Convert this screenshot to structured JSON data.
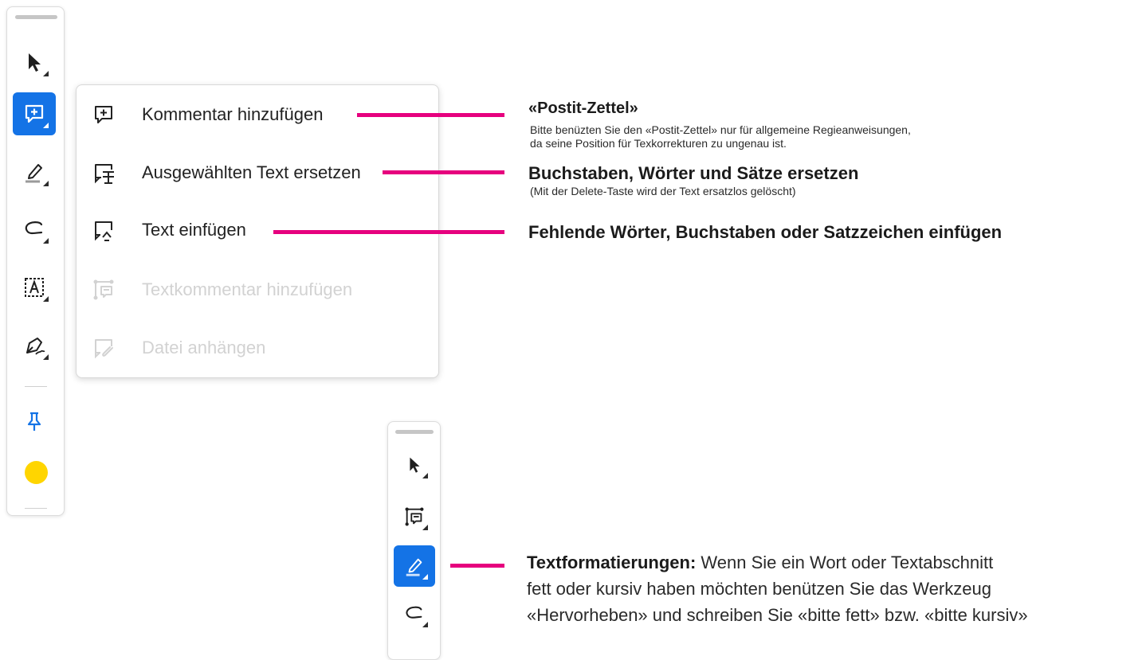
{
  "toolbar": {
    "tools": [
      {
        "icon": "select-arrow-icon",
        "active": false
      },
      {
        "icon": "add-comment-icon",
        "active": true
      },
      {
        "icon": "highlighter-icon",
        "active": false
      },
      {
        "icon": "freehand-draw-icon",
        "active": false
      },
      {
        "icon": "text-box-icon",
        "active": false
      },
      {
        "icon": "sign-pen-icon",
        "active": false
      }
    ],
    "pin_icon": "pin-icon",
    "color_swatch": "#ffd500",
    "accent": "#1473e6"
  },
  "menu": {
    "items": [
      {
        "label": "Kommentar hinzufügen",
        "icon": "add-comment-icon",
        "enabled": true
      },
      {
        "label": "Ausgewählten Text ersetzen",
        "icon": "replace-text-icon",
        "enabled": true
      },
      {
        "label": "Text einfügen",
        "icon": "insert-text-icon",
        "enabled": true
      },
      {
        "label": "Textkommentar hinzufügen",
        "icon": "text-comment-icon",
        "enabled": false
      },
      {
        "label": "Datei anhängen",
        "icon": "attach-file-icon",
        "enabled": false
      }
    ]
  },
  "annotations": {
    "postit": {
      "title": "«Postit-Zettel»",
      "line1": "Bitte benüzten Sie den «Postit-Zettel» nur für allgemeine Regieanweisungen,",
      "line2": "da seine Position für Texkorrekturen zu ungenau ist."
    },
    "replace": {
      "title": "Buchstaben, Wörter und Sätze ersetzen",
      "sub": "(Mit der Delete-Taste wird der Text ersatzlos gelöscht)"
    },
    "insert": {
      "title": "Fehlende Wörter, Buchstaben oder Satzzeichen einfügen"
    },
    "formatting": {
      "bold_label": "Textformatierungen:",
      "line1_rest": " Wenn Sie ein Wort oder Textabschnitt",
      "line2": "fett oder kursiv haben möchten benützen Sie das Werkzeug",
      "line3": "«Hervorheben» und schreiben Sie «bitte fett» bzw. «bitte kursiv»"
    }
  },
  "toolbar2": {
    "tools": [
      {
        "icon": "select-arrow-icon",
        "active": false
      },
      {
        "icon": "text-comment-icon",
        "active": false
      },
      {
        "icon": "highlighter-icon",
        "active": true
      },
      {
        "icon": "freehand-draw-icon",
        "active": false
      }
    ]
  },
  "colors": {
    "annotation_line": "#e6007e",
    "accent": "#1473e6"
  }
}
